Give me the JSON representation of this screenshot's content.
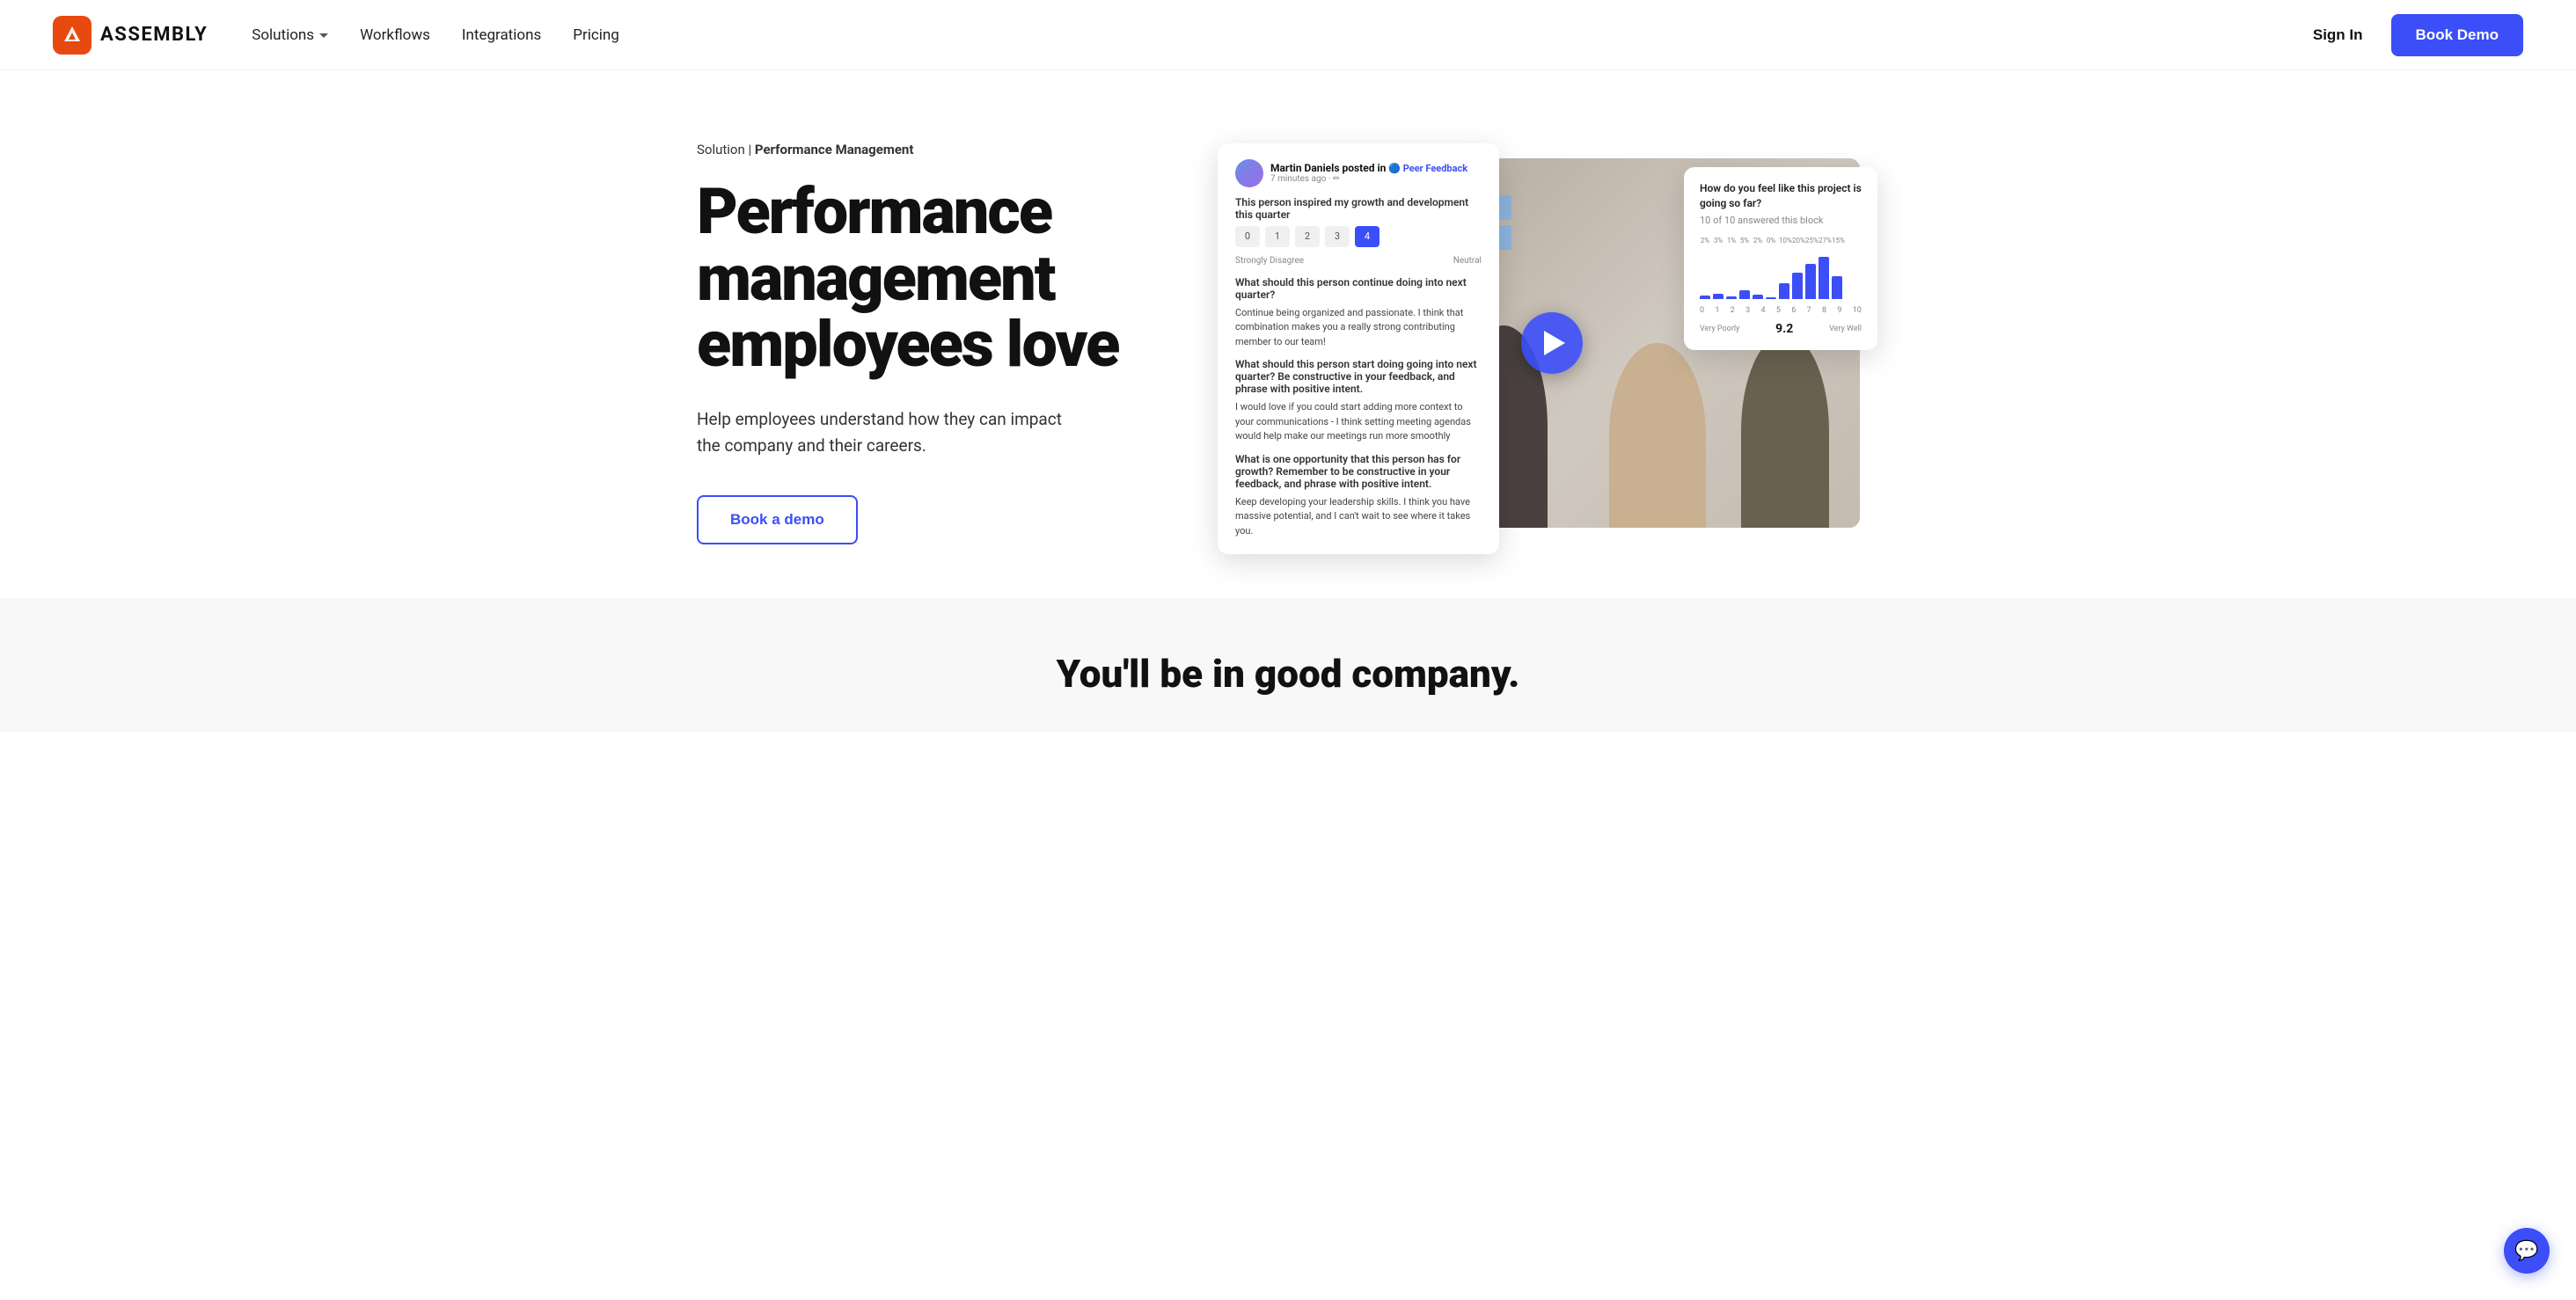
{
  "nav": {
    "logo_text": "ASSEMBLY",
    "links": [
      {
        "id": "solutions",
        "label": "Solutions",
        "has_dropdown": true
      },
      {
        "id": "workflows",
        "label": "Workflows",
        "has_dropdown": false
      },
      {
        "id": "integrations",
        "label": "Integrations",
        "has_dropdown": false
      },
      {
        "id": "pricing",
        "label": "Pricing",
        "has_dropdown": false
      }
    ],
    "sign_in_label": "Sign In",
    "book_demo_label": "Book Demo"
  },
  "hero": {
    "breadcrumb_prefix": "Solution | ",
    "breadcrumb_main": "Performance Management",
    "title": "Performance management employees love",
    "subtitle": "Help employees understand how they can impact the company and their careers.",
    "cta_label": "Book a demo"
  },
  "feedback_card": {
    "poster_name": "Martin Daniels posted in",
    "channel": "🔵 Peer Feedback",
    "time": "7 minutes ago · ✏",
    "question1": "This person inspired my growth and development this quarter",
    "rating_values": [
      "0",
      "1",
      "2",
      "3",
      "4"
    ],
    "active_rating": "4",
    "label_left": "Strongly Disagree",
    "label_right": "Neutral",
    "question2": "What should this person continue doing into next quarter?",
    "answer2": "Continue being organized and passionate. I think that combination makes you a really strong contributing member to our team!",
    "question3": "What should this person start doing going into next quarter? Be constructive in your feedback, and phrase with positive intent.",
    "answer3": "I would love if you could start adding more context to your communications - I think setting meeting agendas would help make our meetings run more smoothly",
    "question4": "What is one opportunity that this person has for growth? Remember to be constructive in your feedback, and phrase with positive intent.",
    "answer4": "Keep developing your leadership skills. I think you have massive potential, and I can't wait to see where it takes you."
  },
  "survey_card": {
    "title": "How do you feel like this project is going so far?",
    "answered": "10 of 10 answered this block",
    "bars": [
      {
        "label": "0",
        "pct": "2",
        "height": 4
      },
      {
        "label": "1",
        "pct": "3%",
        "height": 6
      },
      {
        "label": "2",
        "pct": "1%",
        "height": 3
      },
      {
        "label": "3",
        "pct": "5%",
        "height": 10
      },
      {
        "label": "4",
        "pct": "2%",
        "height": 5
      },
      {
        "label": "5",
        "pct": "0%",
        "height": 2
      },
      {
        "label": "6",
        "pct": "10%",
        "height": 18
      },
      {
        "label": "7",
        "pct": "20%",
        "height": 30
      },
      {
        "label": "8",
        "pct": "25%",
        "height": 40
      },
      {
        "label": "9",
        "pct": "27%",
        "height": 48
      },
      {
        "label": "10",
        "pct": "15%",
        "height": 26
      }
    ],
    "x_labels": [
      "0",
      "1",
      "2",
      "3",
      "4",
      "5",
      "6",
      "7",
      "8",
      "9",
      "10"
    ],
    "score": "9.2",
    "label_very_poorly": "Very Poorly",
    "label_very_well": "Very Well"
  },
  "bottom": {
    "title": "You'll be in good company."
  }
}
